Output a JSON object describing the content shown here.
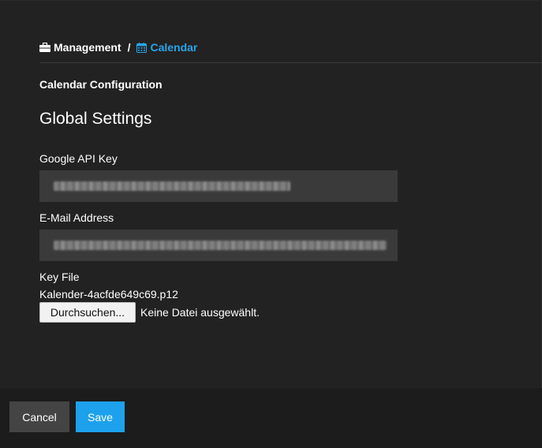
{
  "breadcrumb": {
    "items": [
      {
        "label": "Management",
        "icon": "briefcase-icon"
      },
      {
        "label": "Calendar",
        "icon": "calendar-icon"
      }
    ],
    "separator": "/"
  },
  "section_title": "Calendar Configuration",
  "page_title": "Global Settings",
  "fields": {
    "api_key": {
      "label": "Google API Key",
      "value_redacted": true
    },
    "email": {
      "label": "E-Mail Address",
      "value_redacted": true
    }
  },
  "key_file": {
    "label": "Key File",
    "filename": "Kalender-4acfde649c69.p12",
    "browse_label": "Durchsuchen...",
    "status": "Keine Datei ausgewählt."
  },
  "footer": {
    "cancel_label": "Cancel",
    "save_label": "Save"
  },
  "colors": {
    "accent": "#2aa4e8",
    "save_button": "#1da1ec",
    "cancel_button": "#444444",
    "background": "#222222"
  }
}
